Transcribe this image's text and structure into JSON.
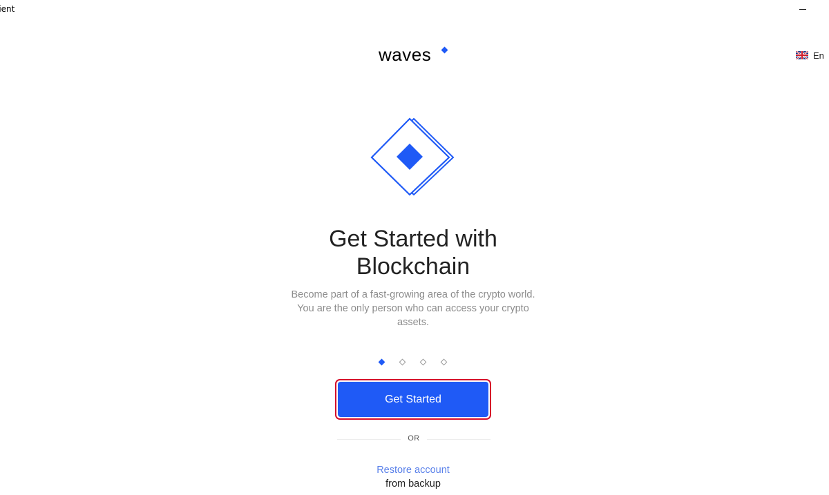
{
  "window": {
    "title": "lient"
  },
  "header": {
    "logo_text": "waves",
    "language": {
      "label": "En",
      "flag_icon": "uk-flag-icon"
    }
  },
  "hero": {
    "icon": "waves-diamond-icon",
    "headline_line1": "Get Started with",
    "headline_line2": "Blockchain",
    "description": "Become part of a fast-growing area of the crypto world. You are the only person who can access your crypto assets."
  },
  "carousel": {
    "total": 4,
    "active_index": 0
  },
  "actions": {
    "get_started_label": "Get Started",
    "or_label": "OR",
    "restore_label": "Restore account",
    "restore_sub_label": "from backup"
  },
  "colors": {
    "accent": "#1f5af6",
    "highlight_border": "#d60d2a",
    "link": "#5a81ea",
    "muted_text": "#8c8c8c"
  }
}
